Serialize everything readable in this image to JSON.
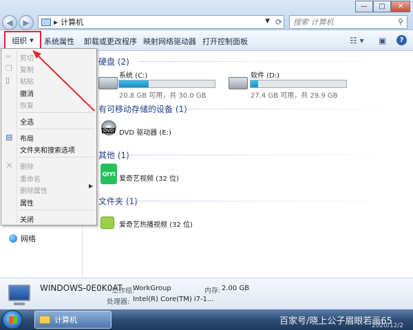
{
  "window": {
    "address": "计算机",
    "search_placeholder": "搜索 计算机",
    "controls": {
      "minimize": "—",
      "maximize": "□",
      "close": "✕"
    }
  },
  "toolbar": {
    "organize": "组织",
    "items": [
      "系统属性",
      "卸载或更改程序",
      "映射网络驱动器",
      "打开控制面板"
    ]
  },
  "navpane": {
    "network": "网络"
  },
  "content": {
    "hdd_section": "硬盘 (2)",
    "drives": [
      {
        "name": "系统 (C:)",
        "free": "20.8 GB 可用，共 30.0 GB",
        "used_fraction": 0.31
      },
      {
        "name": "软件 (D:)",
        "free": "27.4 GB 可用，共 29.9 GB",
        "used_fraction": 0.08
      }
    ],
    "removable_section": "有可移动存储的设备 (1)",
    "dvd": "DVD 驱动器 (E:)",
    "other_section": "其他 (1)",
    "other_item": "爱奇艺视频 (32 位)",
    "other_icon_text": "QIYI",
    "folder_section": "文件夹 (1)",
    "folder_item": "爱奇艺热播视频 (32 位)",
    "dvd_label": "DVD"
  },
  "details": {
    "computer_name": "WINDOWS-0E0K0AT",
    "workgroup_label": "工作组:",
    "workgroup": "WorkGroup",
    "memory_label": "内存:",
    "memory": "2.00 GB",
    "cpu_label": "处理器:",
    "cpu": "Intel(R) Core(TM) i7-1..."
  },
  "menu": {
    "items": [
      {
        "label": "剪切",
        "disabled": true
      },
      {
        "label": "复制",
        "disabled": true
      },
      {
        "label": "粘贴",
        "disabled": true
      },
      {
        "label": "撤消",
        "disabled": false
      },
      {
        "label": "恢复",
        "disabled": true
      },
      {
        "label": "全选",
        "disabled": false
      },
      {
        "label": "布局",
        "disabled": false
      },
      {
        "label": "文件夹和搜索选项",
        "disabled": false
      },
      {
        "label": "删除",
        "disabled": true
      },
      {
        "label": "重命名",
        "disabled": true
      },
      {
        "label": "删除属性",
        "disabled": true
      },
      {
        "label": "属性",
        "disabled": false
      },
      {
        "label": "关闭",
        "disabled": false
      }
    ]
  },
  "taskbar": {
    "explorer": "计算机"
  },
  "watermark": {
    "text": "百家号/晓上公子眉眼若画65",
    "date": "2020/12/2"
  },
  "colors": {
    "highlight": "#e3262b",
    "drive_fill": "#1d8cc5",
    "section": "#1e3f86"
  }
}
